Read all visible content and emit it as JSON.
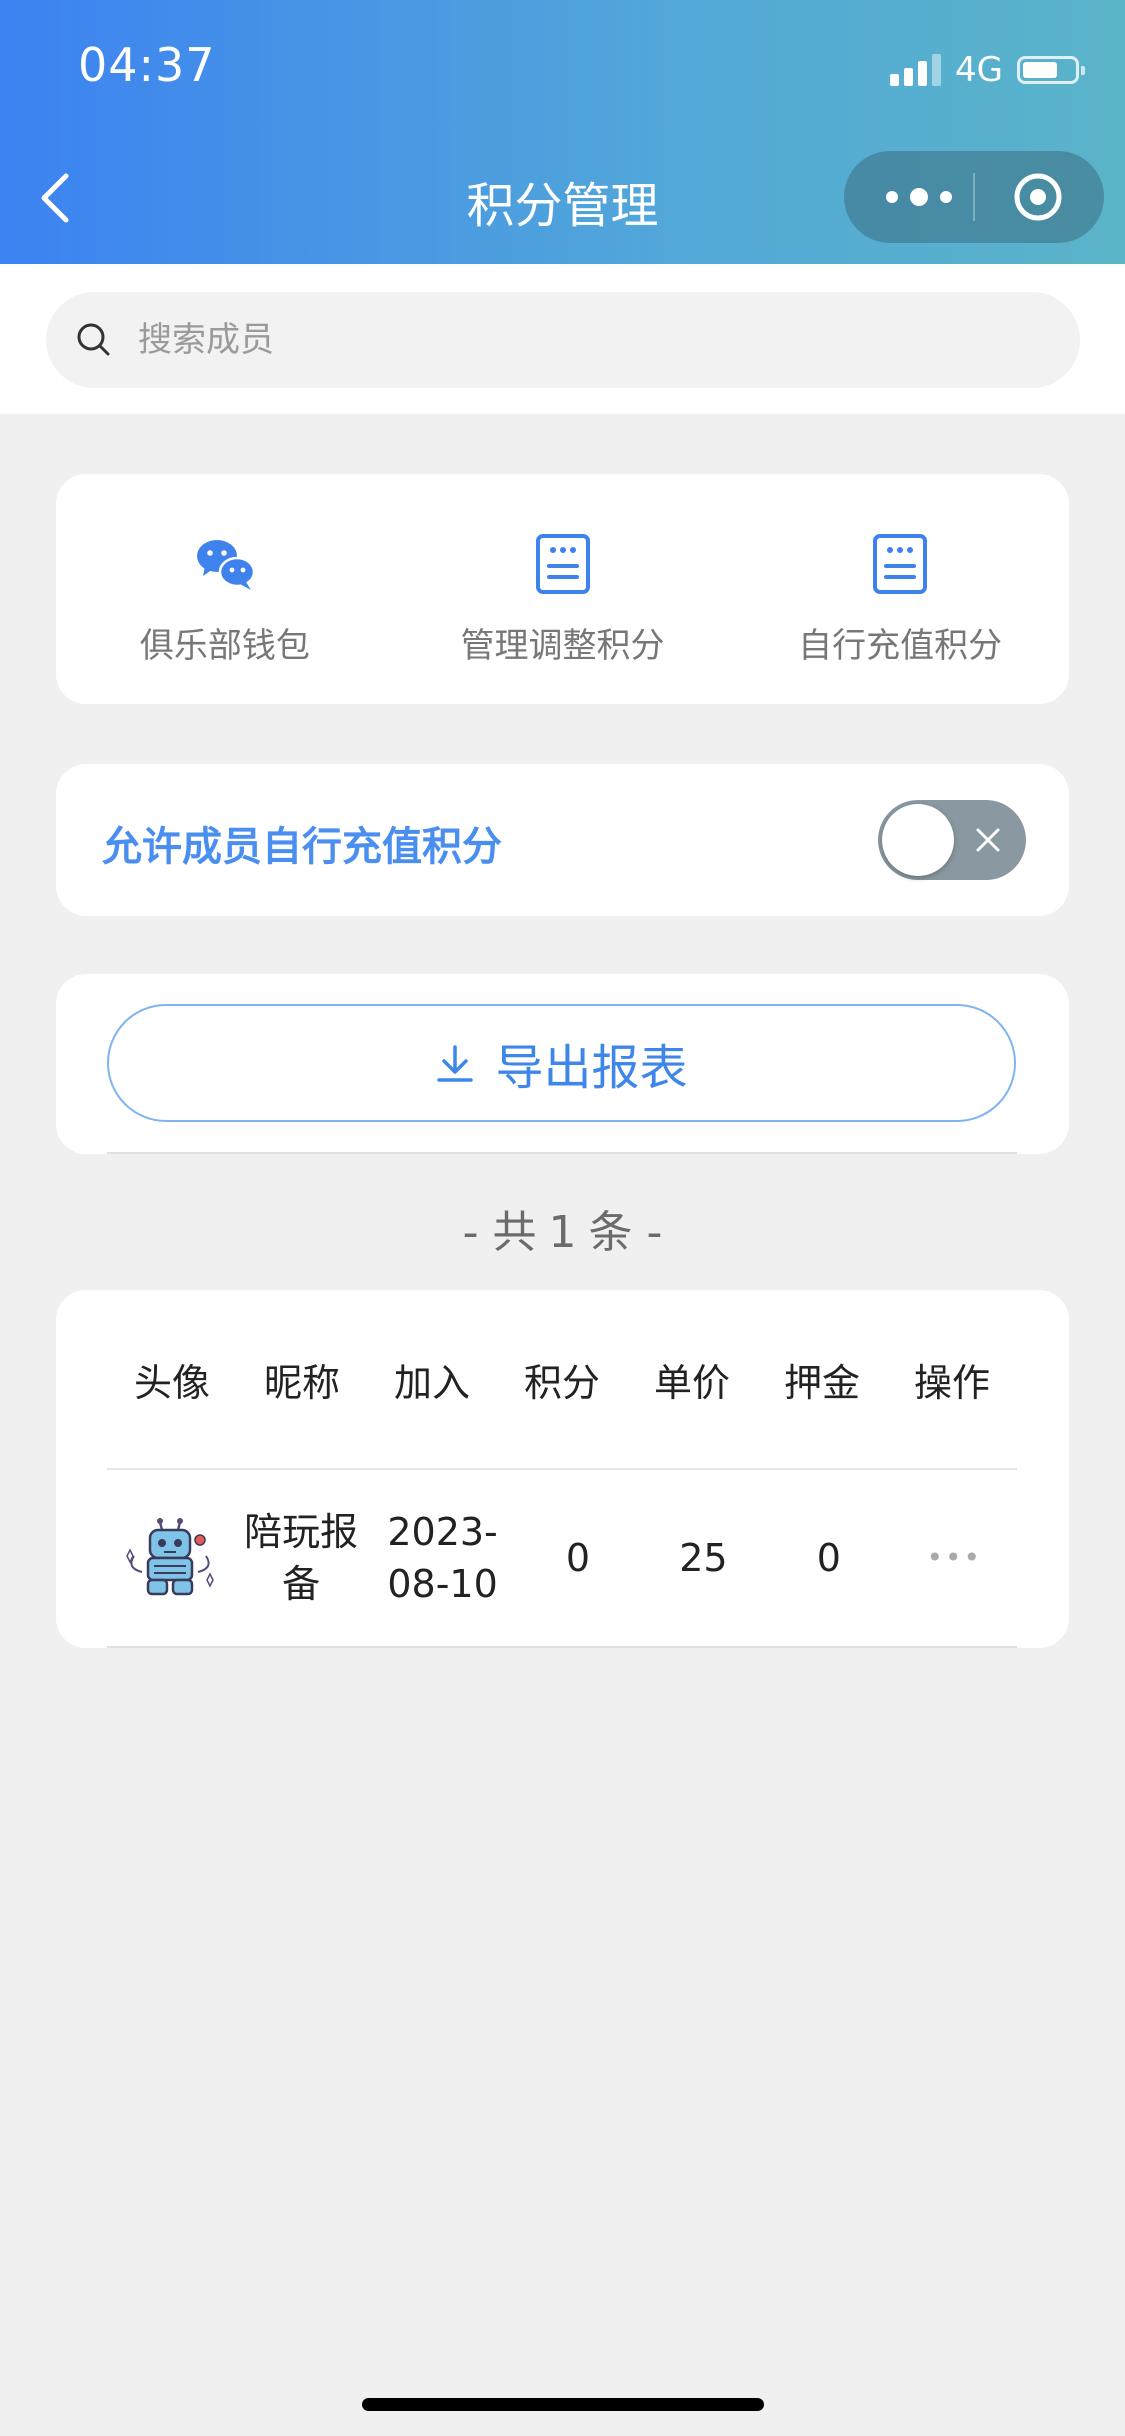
{
  "status": {
    "time": "04:37",
    "network": "4G",
    "battery_level": 0.55
  },
  "nav": {
    "title": "积分管理"
  },
  "search": {
    "placeholder": "搜索成员"
  },
  "actions": [
    {
      "label": "俱乐部钱包",
      "icon": "wechat-icon"
    },
    {
      "label": "管理调整积分",
      "icon": "document-icon"
    },
    {
      "label": "自行充值积分",
      "icon": "document-icon"
    }
  ],
  "toggle": {
    "label": "允许成员自行充值积分",
    "enabled": false
  },
  "export": {
    "label": "导出报表"
  },
  "summary": {
    "prefix": "- 共",
    "count": "1",
    "suffix": "条 -"
  },
  "table": {
    "headers": [
      "头像",
      "昵称",
      "加入",
      "积分",
      "单价",
      "押金",
      "操作"
    ],
    "rows": [
      {
        "nickname": "陪玩报备",
        "join_date": "2023-08-10",
        "points": "0",
        "unit_price": "25",
        "deposit": "0",
        "ops": "•••"
      }
    ]
  },
  "colors": {
    "accent": "#3f86ea",
    "header_start": "#3c82f2",
    "header_end": "#5ab4c8",
    "switch_off": "#8a99a1"
  }
}
